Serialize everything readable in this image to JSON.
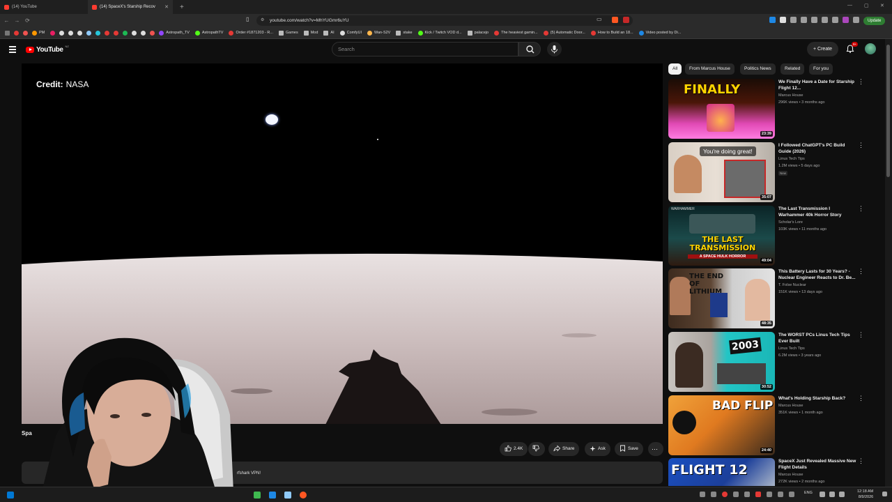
{
  "browser": {
    "tabs": [
      {
        "title": "(14) YouTube",
        "active": false
      },
      {
        "title": "(14) SpaceX's Starship Recov",
        "active": true
      }
    ],
    "url": "youtube.com/watch?v=MhYUGmr6uYU",
    "update_label": "Update",
    "bookmarks": [
      "PM",
      "Astropath_TV",
      "AstropathTV",
      "Order #1871203 - R...",
      "Games",
      "Mod",
      "AI",
      "ComfyUI",
      "Wan-S2V",
      "stake",
      "Kick / Twitch VOD d...",
      "palacejo",
      "The heaviest gamin...",
      "(5) Automatic Door...",
      "How to Build an 18...",
      "Video posted by Di..."
    ]
  },
  "youtube": {
    "logo_text": "YouTube",
    "country_code": "NZ",
    "search_placeholder": "Search",
    "create_label": "Create",
    "notif_count": "9+"
  },
  "player": {
    "credit_label": "Credit:",
    "credit_value": "NASA"
  },
  "video": {
    "title_partial": "Spa",
    "likes": "2.4K",
    "share_label": "Share",
    "ask_label": "Ask",
    "save_label": "Save",
    "description_snippet": "rfshark VPN!"
  },
  "chips": [
    "All",
    "From Marcus House",
    "Politics News",
    "Related",
    "For you"
  ],
  "recommendations": [
    {
      "title": "We Finally Have a Date for Starship Flight 12...",
      "channel": "Marcus House",
      "meta": "296K views • 3 months ago",
      "duration": "23:39",
      "thumb_text": "FINALLY",
      "new": ""
    },
    {
      "title": "I Followed ChatGPT's PC Build Guide (2026)",
      "channel": "Linus Tech Tips",
      "meta": "1.2M views • 5 days ago",
      "duration": "35:07",
      "thumb_text": "You're doing great!",
      "new": "New"
    },
    {
      "title": "The Last Transmission I Warhammer 40k Horror Story",
      "channel": "Scholar's Lore",
      "meta": "103K views • 11 months ago",
      "duration": "49:04",
      "thumb_text": "THE LAST TRANSMISSION",
      "thumb_sub": "A SPACE HULK HORROR",
      "thumb_top": "WARHAMMER",
      "new": ""
    },
    {
      "title": "This Battery Lasts for 30 Years? - Nuclear Engineer Reacts to Dr. Be...",
      "channel": "T. Folse Nuclear",
      "meta": "151K views • 13 days ago",
      "duration": "48:35",
      "thumb_text": "THE END OF LITHIUM",
      "new": ""
    },
    {
      "title": "The WORST PCs Linus Tech Tips Ever Built",
      "channel": "Linus Tech Tips",
      "meta": "6.2M views • 3 years ago",
      "duration": "30:52",
      "thumb_text": "2003",
      "new": ""
    },
    {
      "title": "What's Holding Starship Back?",
      "channel": "Marcus House",
      "meta": "351K views • 1 month ago",
      "duration": "24:40",
      "thumb_text": "BAD FLIP",
      "new": ""
    },
    {
      "title": "SpaceX Just Revealed Massive New Flight Details",
      "channel": "Marcus House",
      "meta": "272K views • 2 months ago",
      "duration": "",
      "thumb_text": "FLIGHT 12",
      "new": ""
    }
  ],
  "taskbar": {
    "language": "ENG",
    "time": "12:18 AM",
    "date": "8/9/2026"
  },
  "colors": {
    "yt_red": "#ff0000",
    "bg": "#0f0f0f",
    "chip_bg": "#272727"
  }
}
